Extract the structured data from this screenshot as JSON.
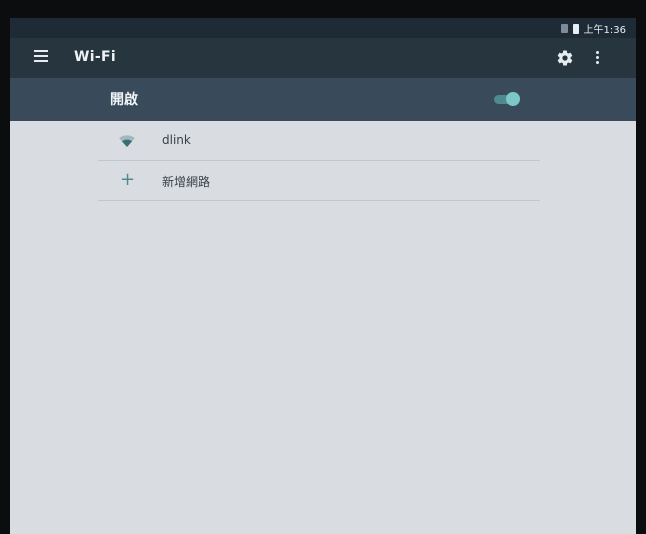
{
  "status_bar": {
    "time": "上午1:36"
  },
  "app_bar": {
    "title": "Wi-Fi"
  },
  "master_switch": {
    "label": "開啟",
    "state": "on"
  },
  "networks": [
    {
      "name": "dlink",
      "icon": "wifi-icon"
    }
  ],
  "add_network": {
    "label": "新增網路",
    "icon": "plus-icon"
  },
  "colors": {
    "app_bar": "#27353f",
    "master_row": "#394b5a",
    "accent": "#7ec7c9",
    "background": "#d9dde2"
  }
}
